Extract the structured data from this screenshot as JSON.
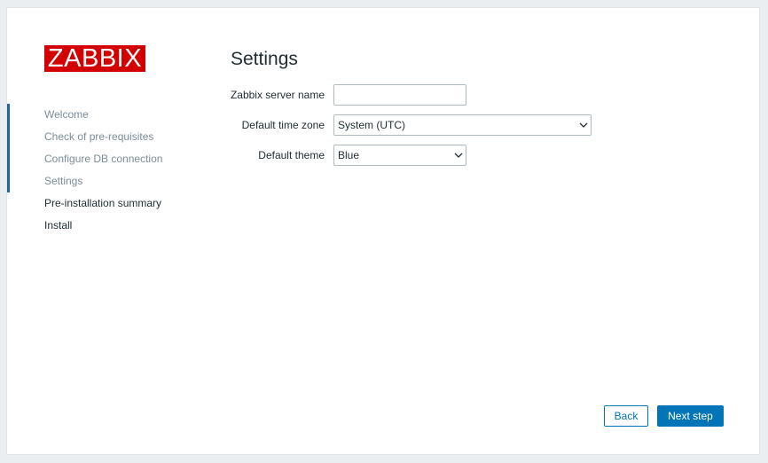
{
  "logo": {
    "text": "ZABBIX"
  },
  "steps": [
    {
      "label": "Welcome",
      "state": "done"
    },
    {
      "label": "Check of pre-requisites",
      "state": "done"
    },
    {
      "label": "Configure DB connection",
      "state": "done"
    },
    {
      "label": "Settings",
      "state": "current"
    },
    {
      "label": "Pre-installation summary",
      "state": "pending"
    },
    {
      "label": "Install",
      "state": "pending"
    }
  ],
  "main": {
    "title": "Settings",
    "fields": {
      "server_name": {
        "label": "Zabbix server name",
        "value": ""
      },
      "time_zone": {
        "label": "Default time zone",
        "value": "System (UTC)"
      },
      "theme": {
        "label": "Default theme",
        "value": "Blue"
      }
    }
  },
  "buttons": {
    "back": "Back",
    "next": "Next step"
  },
  "colors": {
    "brand_red": "#d40000",
    "accent_blue": "#0275b8",
    "step_done": "#7b8e9a",
    "step_pending": "#1f2c33",
    "progress_bar": "#1f65a6"
  },
  "icons": {
    "select_arrow": "chevron-down-icon"
  }
}
